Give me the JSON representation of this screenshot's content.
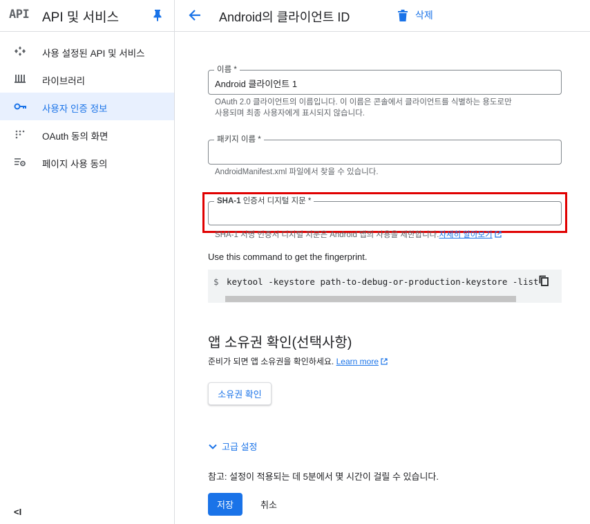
{
  "sidebar": {
    "logo": "API",
    "title": "API 및 서비스",
    "items": [
      {
        "label": "사용 설정된 API 및 서비스",
        "icon": "dashboard-icon"
      },
      {
        "label": "라이브러리",
        "icon": "library-icon"
      },
      {
        "label": "사용자 인증 정보",
        "icon": "key-icon",
        "active": true
      },
      {
        "label": "OAuth 동의 화면",
        "icon": "oauth-icon"
      },
      {
        "label": "페이지 사용 동의",
        "icon": "settings-list-icon"
      }
    ],
    "collapse": "<I"
  },
  "header": {
    "title": "Android의 클라이언트 ID",
    "delete_label": "삭제"
  },
  "form": {
    "name": {
      "label": "이름 *",
      "value": "Android 클라이언트 1",
      "hint_line1": "OAuth 2.0 클라이언트의 이름입니다. 이 이름은 콘솔에서 클라이언트를 식별하는 용도로만",
      "hint_line2": "사용되며 최종 사용자에게 표시되지 않습니다."
    },
    "package": {
      "label": "패키지 이름 *",
      "value": "",
      "hint": "AndroidManifest.xml 파일에서 찾을 수 있습니다."
    },
    "sha1": {
      "label_bold": "SHA-1",
      "label_rest": " 인증서 디지털 지문 *",
      "value": "",
      "hint": "SHA-1 서명 인증서 디지털 지문은 Android 앱의 사용을 제한합니다.",
      "hint_link": "자세히 알아보기"
    },
    "command_label": "Use this command to get the fingerprint.",
    "command_prompt": "$",
    "command_text": "keytool -keystore path-to-debug-or-production-keystore -list"
  },
  "ownership": {
    "title": "앱 소유권 확인(선택사항)",
    "desc": "준비가 되면 앱 소유권을 확인하세요.",
    "desc_link": "Learn more",
    "verify_label": "소유권 확인"
  },
  "advanced_label": "고급 설정",
  "note": "참고: 설정이 적용되는 데 5분에서 몇 시간이 걸릴 수 있습니다.",
  "actions": {
    "save_label": "저장",
    "cancel_label": "취소"
  },
  "colors": {
    "accent": "#1a73e8",
    "highlight": "#e00000",
    "active_bg": "#e8f0fe"
  }
}
